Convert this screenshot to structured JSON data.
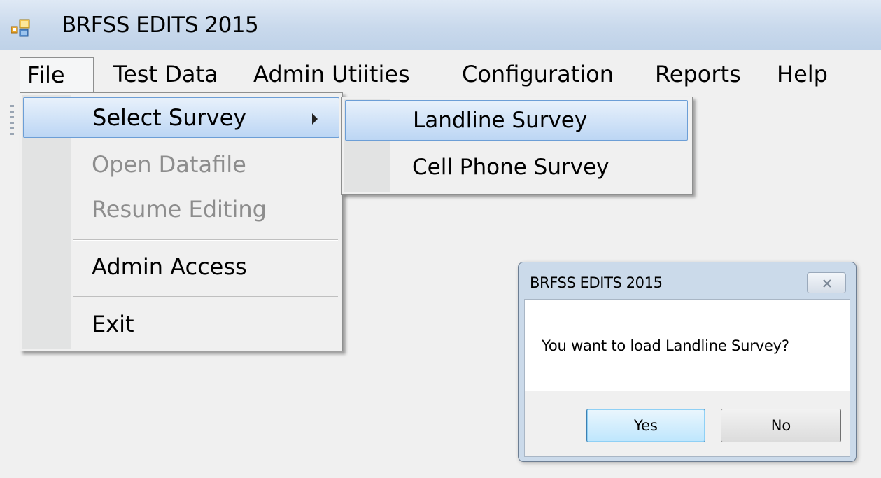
{
  "window": {
    "title": "BRFSS EDITS 2015",
    "app_icon": "windows-form-icon"
  },
  "menubar": {
    "items": [
      {
        "label": "File"
      },
      {
        "label": "Test Data"
      },
      {
        "label": "Admin Utiities"
      },
      {
        "label": "Configuration"
      },
      {
        "label": "Reports"
      },
      {
        "label": "Help"
      }
    ]
  },
  "file_menu": {
    "items": [
      {
        "label": "Select Survey",
        "state": "highlighted",
        "has_submenu": true
      },
      {
        "label": "Open Datafile",
        "state": "disabled"
      },
      {
        "label": "Resume Editing",
        "state": "disabled"
      },
      {
        "label": "Admin Access",
        "state": "enabled"
      },
      {
        "label": "Exit",
        "state": "enabled"
      }
    ]
  },
  "submenu": {
    "items": [
      {
        "label": "Landline Survey",
        "state": "highlighted"
      },
      {
        "label": "Cell Phone Survey",
        "state": "enabled"
      }
    ]
  },
  "dialog": {
    "title": "BRFSS EDITS 2015",
    "message": "You want to load Landline Survey?",
    "yes_label": "Yes",
    "no_label": "No"
  },
  "colors": {
    "highlight_border": "#6c9ed6",
    "titlebar": "#c9d9ec",
    "disabled_text": "#8d8d8d"
  }
}
